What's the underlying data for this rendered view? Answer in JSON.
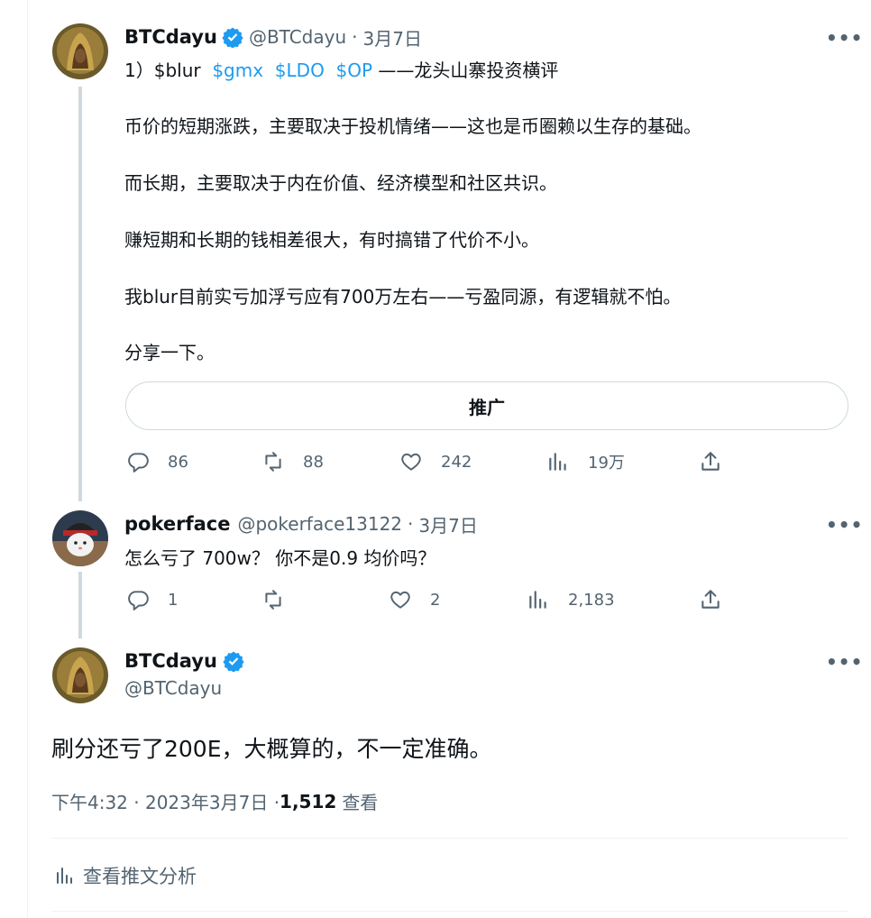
{
  "tweet1": {
    "name": "BTCdayu",
    "handle": "@BTCdayu",
    "date": "3月7日",
    "line1_prefix": "1）$blur",
    "cashtags": [
      "$gmx",
      "$LDO",
      "$OP"
    ],
    "line1_suffix": "——龙头山寨投资横评",
    "paragraphs": [
      "币价的短期涨跌，主要取决于投机情绪——这也是币圈赖以生存的基础。",
      "而长期，主要取决于内在价值、经济模型和社区共识。",
      "赚短期和长期的钱相差很大，有时搞错了代价不小。",
      "我blur目前实亏加浮亏应有700万左右——亏盈同源，有逻辑就不怕。",
      "分享一下。"
    ],
    "promote_label": "推广",
    "actions": {
      "replies": "86",
      "retweets": "88",
      "likes": "242",
      "views": "19万"
    }
  },
  "tweet2": {
    "name": "pokerface",
    "handle": "@pokerface13122",
    "date": "3月7日",
    "text": "怎么亏了 700w？ 你不是0.9 均价吗？",
    "actions": {
      "replies": "1",
      "retweets": "",
      "likes": "2",
      "views": "2,183"
    }
  },
  "main_tweet": {
    "name": "BTCdayu",
    "handle": "@BTCdayu",
    "text": "刷分还亏了200E，大概算的，不一定准确。",
    "timestamp": "下午4:32 · 2023年3月7日 · ",
    "view_count": "1,512",
    "view_label": "查看",
    "analytics_label": "查看推文分析"
  },
  "dot": "·",
  "more_glyph": "•••",
  "colors": {
    "accent": "#1d9bf0",
    "secondary": "#536471",
    "border": "#cfd9de"
  }
}
